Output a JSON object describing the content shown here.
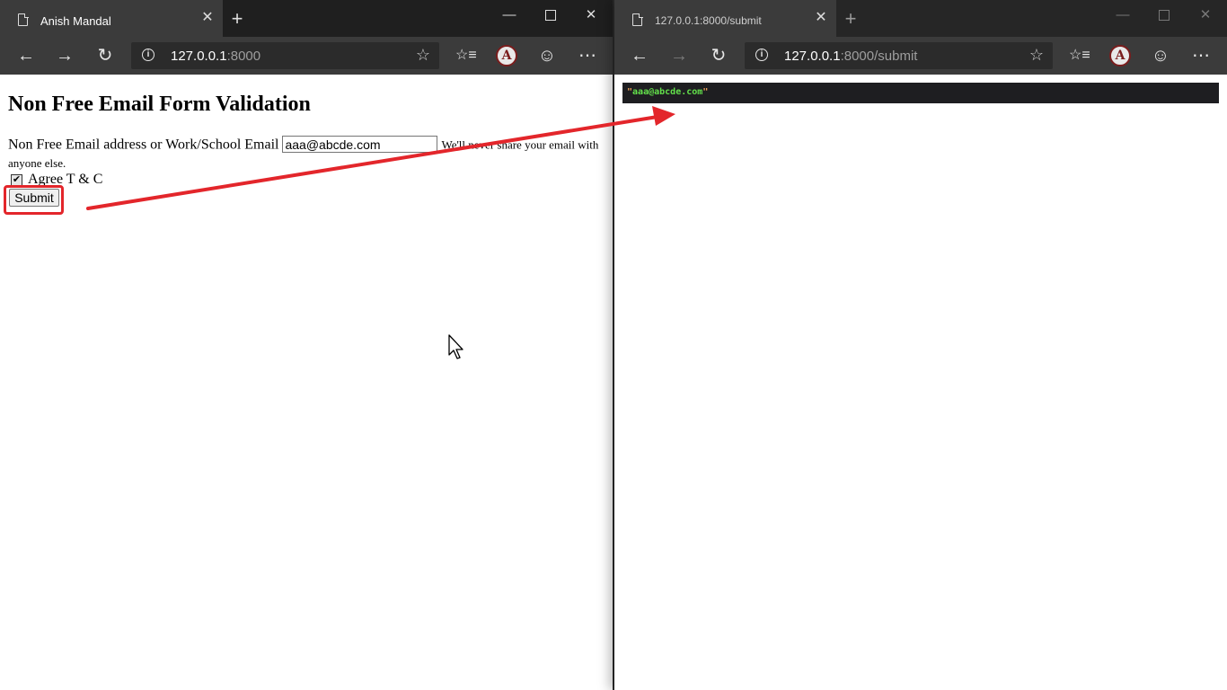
{
  "left_window": {
    "tab_title": "Anish Mandal",
    "url_host": "127.0.0.1",
    "url_rest": ":8000",
    "page": {
      "title": "Non Free Email Form Validation",
      "email_label": "Non Free Email address or Work/School Email",
      "email_value": "aaa@abcde.com",
      "help_text": "We'll never share your email with anyone else.",
      "checkbox_label": "Agree T & C",
      "checkbox_checked": true,
      "submit_label": "Submit"
    }
  },
  "right_window": {
    "tab_title": "127.0.0.1:8000/submit",
    "url_host": "127.0.0.1",
    "url_rest": ":8000/submit",
    "response_value": "aaa@abcde.com"
  },
  "icons": {
    "tab_close": "✕",
    "new_tab": "+",
    "minimize": "—",
    "close": "✕",
    "back": "←",
    "forward": "→",
    "refresh": "↻",
    "favorite": "☆",
    "favorites_list": "☆≡",
    "feedback": "☺",
    "more": "⋯",
    "check": "✔"
  },
  "colors": {
    "annotation_red": "#e3262b",
    "json_green": "#63e04b",
    "chrome_dark": "#1f1f1f",
    "toolbar": "#3b3b3b"
  }
}
